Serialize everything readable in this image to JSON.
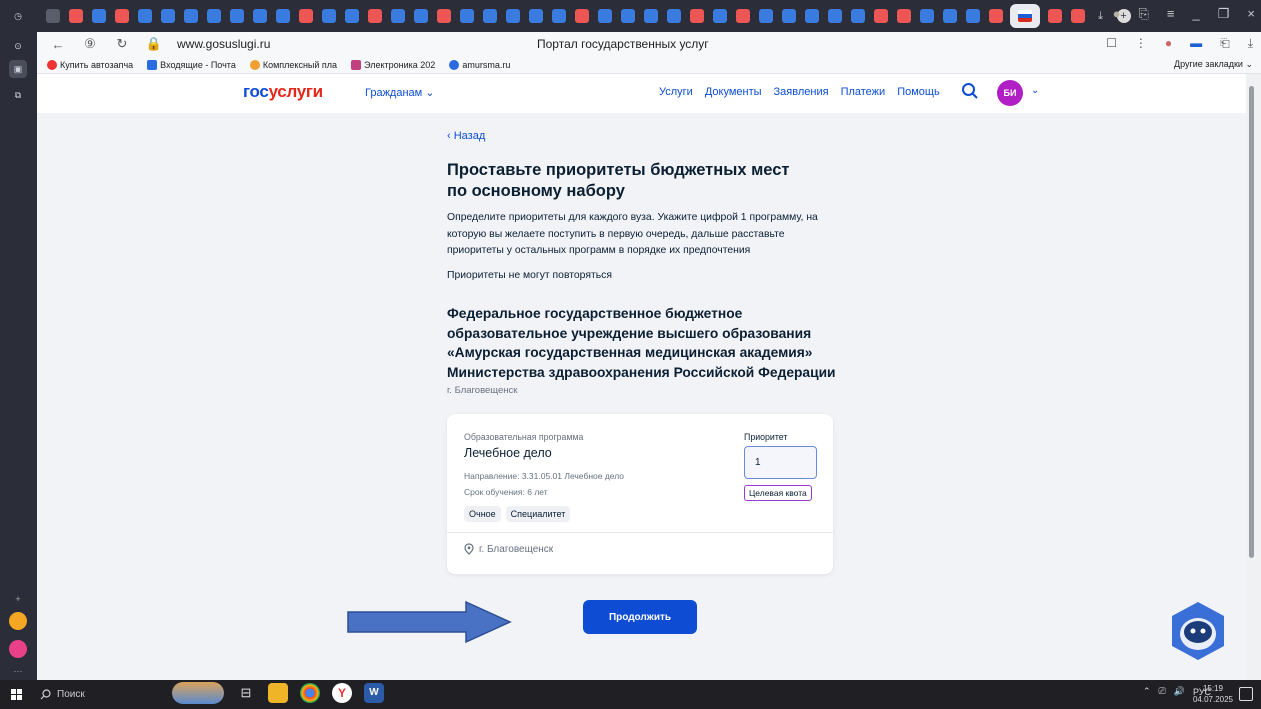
{
  "browser": {
    "url": "www.gosuslugi.ru",
    "page_title": "Портал государственных услуг",
    "bookmarks": [
      "Купить автозапча",
      "Входящие - Почта",
      "Комплексный пла",
      "Электроника 202",
      "amursma.ru"
    ],
    "other_bookmarks": "Другие закладки"
  },
  "header": {
    "logo_part1": "гос",
    "logo_part2": "услуги",
    "citizens_menu": "Гражданам",
    "nav": [
      "Услуги",
      "Документы",
      "Заявления",
      "Платежи",
      "Помощь"
    ],
    "avatar_initials": "БИ"
  },
  "main": {
    "back": "Назад",
    "title": "Проставьте приоритеты бюджетных мест по основному набору",
    "lead": "Определите приоритеты для каждого вуза. Укажите цифрой 1 программу, на которую вы желаете поступить в первую очередь, дальше расставьте приоритеты у остальных программ в порядке их предпочтения",
    "note": "Приоритеты не могут повторяться",
    "university": "Федеральное государственное бюджетное образовательное учреждение высшего образования «Амурская государственная медицинская академия» Министерства здравоохранения Российской Федерации",
    "city": "г. Благовещенск",
    "card": {
      "program_label": "Образовательная программа",
      "program": "Лечебное дело",
      "direction": "Направление: 3.31.05.01 Лечебное дело",
      "duration": "Срок обучения: 6 лет",
      "chips": [
        "Очное",
        "Специалитет"
      ],
      "priority_label": "Приоритет",
      "priority_value": "1",
      "quota": "Целевая квота",
      "location": "г. Благовещенск"
    },
    "continue_button": "Продолжить"
  },
  "taskbar": {
    "search": "Поиск",
    "lang": "РУС",
    "time": "15:19",
    "date": "04.07.2025"
  },
  "colors": {
    "brand_blue": "#0d4cd3",
    "brand_red": "#e3271b",
    "avatar": "#b01fc4",
    "quota_border": "#9b3ad6"
  }
}
